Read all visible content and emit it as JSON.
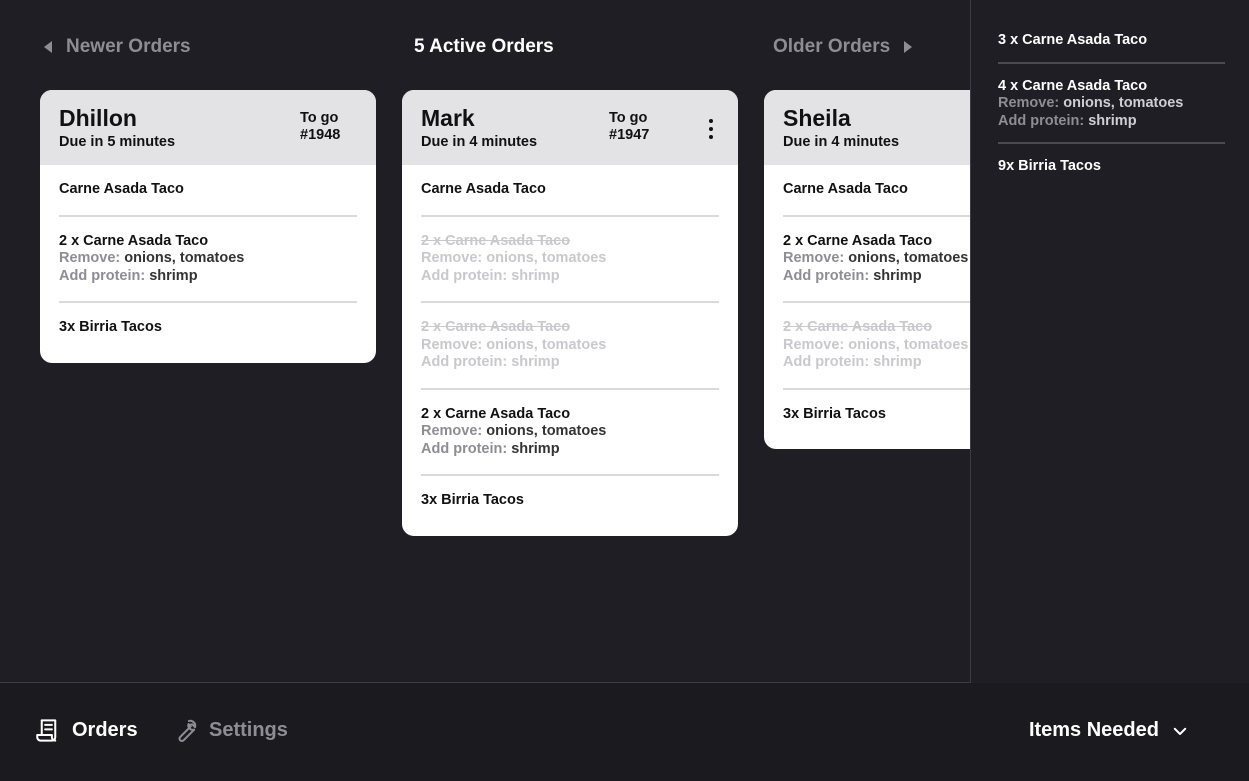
{
  "nav": {
    "newer": "Newer Orders",
    "title": "5 Active Orders",
    "older": "Older Orders"
  },
  "orders": [
    {
      "name": "Dhillon",
      "due": "Due in 5 minutes",
      "type": "To go",
      "number": "#1948",
      "items": [
        {
          "title": "Carne Asada Taco"
        },
        {
          "title": "2 x Carne Asada Taco",
          "remove_label": "Remove:",
          "remove": "onions, tomatoes",
          "protein_label": "Add protein:",
          "protein": "shrimp"
        },
        {
          "title": "3x Birria Tacos"
        }
      ]
    },
    {
      "name": "Mark",
      "due": "Due in 4 minutes",
      "type": "To go",
      "number": "#1947",
      "items": [
        {
          "title": "Carne Asada Taco"
        },
        {
          "title": "2 x Carne Asada Taco",
          "remove_label": "Remove:",
          "remove": "onions, tomatoes",
          "protein_label": "Add protein:",
          "protein": "shrimp",
          "done": true
        },
        {
          "title": "2 x Carne Asada Taco",
          "remove_label": "Remove:",
          "remove": "onions, tomatoes",
          "protein_label": "Add protein:",
          "protein": "shrimp",
          "done": true
        },
        {
          "title": "2 x Carne Asada Taco",
          "remove_label": "Remove:",
          "remove": "onions, tomatoes",
          "protein_label": "Add protein:",
          "protein": "shrimp"
        },
        {
          "title": "3x Birria Tacos"
        }
      ]
    },
    {
      "name": "Sheila",
      "due": "Due in 4 minutes",
      "items": [
        {
          "title": "Carne Asada Taco"
        },
        {
          "title": "2 x Carne Asada Taco",
          "remove_label": "Remove:",
          "remove": "onions, tomatoes",
          "protein_label": "Add protein:",
          "protein": "shrimp"
        },
        {
          "title": "2 x Carne Asada Taco",
          "remove_label": "Remove:",
          "remove": "onions, tomatoes",
          "protein_label": "Add protein:",
          "protein": "shrimp",
          "done": true
        },
        {
          "title": "3x Birria Tacos"
        }
      ]
    }
  ],
  "side_panel": {
    "items": [
      {
        "title": "3 x Carne Asada Taco"
      },
      {
        "title": "4 x Carne Asada Taco",
        "remove_label": "Remove:",
        "remove": "onions, tomatoes",
        "protein_label": "Add protein:",
        "protein": "shrimp"
      },
      {
        "title": "9x Birria Tacos"
      }
    ]
  },
  "bottom_bar": {
    "orders": "Orders",
    "settings": "Settings",
    "items_needed": "Items Needed"
  }
}
